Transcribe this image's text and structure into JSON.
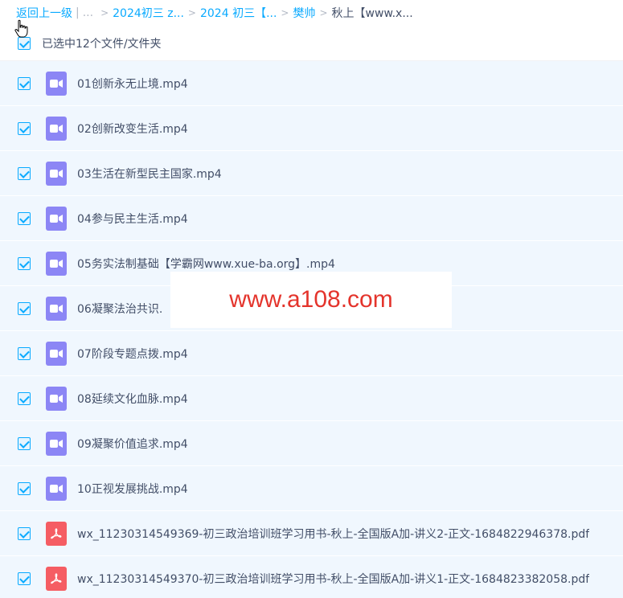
{
  "breadcrumb": {
    "back": "返回上一级",
    "pipe": "|",
    "dots": "...",
    "sep": ">",
    "items": [
      "2024初三 z...",
      "2024 初三【...",
      "樊帅"
    ],
    "current": "秋上【www.x..."
  },
  "header": {
    "selection_label": "已选中12个文件/文件夹"
  },
  "files": [
    {
      "name": "01创新永无止境.mp4",
      "type": "video"
    },
    {
      "name": "02创新改变生活.mp4",
      "type": "video"
    },
    {
      "name": "03生活在新型民主国家.mp4",
      "type": "video"
    },
    {
      "name": "04参与民主生活.mp4",
      "type": "video"
    },
    {
      "name": "05务实法制基础【学霸网www.xue-ba.org】.mp4",
      "type": "video"
    },
    {
      "name": "06凝聚法治共识.",
      "type": "video"
    },
    {
      "name": "07阶段专题点拨.mp4",
      "type": "video"
    },
    {
      "name": "08延续文化血脉.mp4",
      "type": "video"
    },
    {
      "name": "09凝聚价值追求.mp4",
      "type": "video"
    },
    {
      "name": "10正视发展挑战.mp4",
      "type": "video"
    },
    {
      "name": "wx_11230314549369-初三政治培训班学习用书-秋上-全国版A加-讲义2-正文-1684822946378.pdf",
      "type": "pdf"
    },
    {
      "name": "wx_11230314549370-初三政治培训班学习用书-秋上-全国版A加-讲义1-正文-1684823382058.pdf",
      "type": "pdf"
    }
  ],
  "watermark": {
    "text": "www.a108.com"
  },
  "colors": {
    "accent": "#09aaff",
    "row_selected": "#f0f7fe",
    "video_icon": "#8c86f5",
    "pdf_icon": "#f55d63",
    "watermark": "#e4342c"
  }
}
